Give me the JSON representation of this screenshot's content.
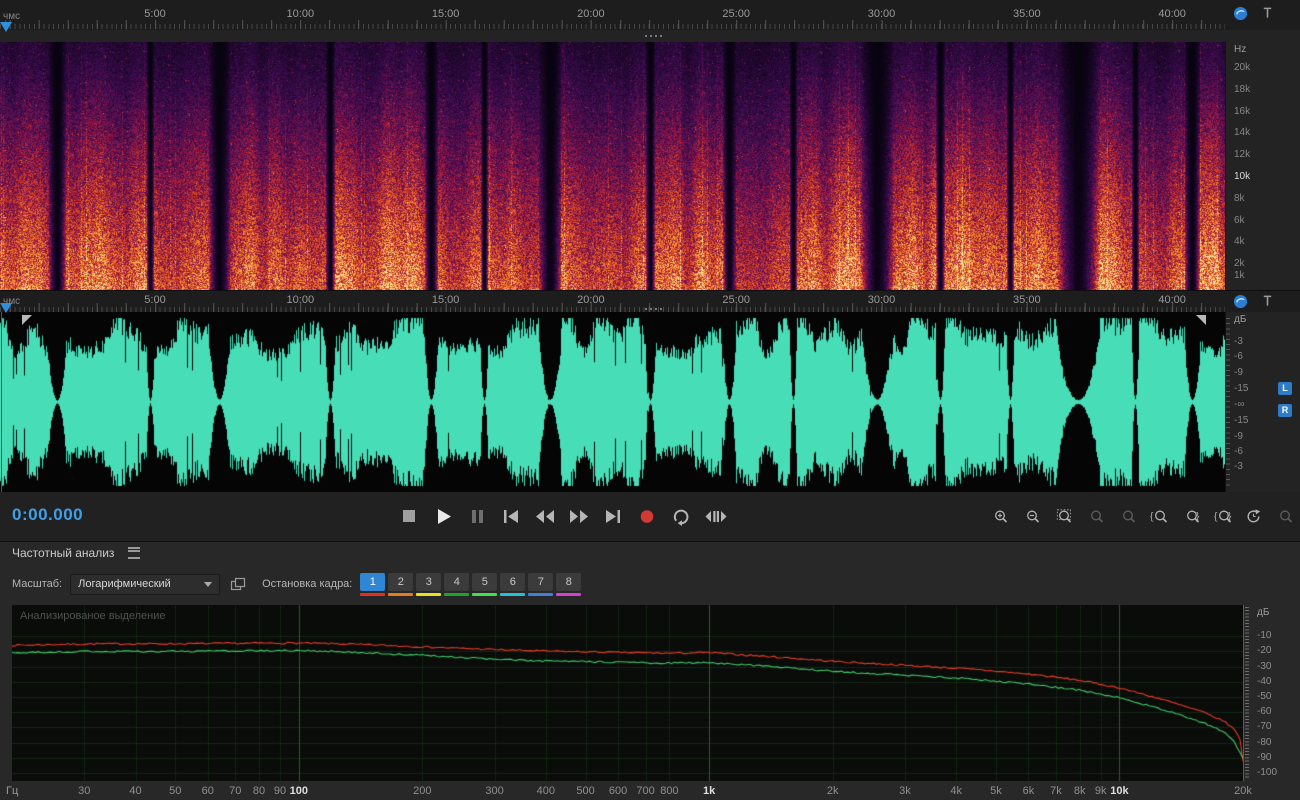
{
  "colors": {
    "accent_blue": "#2f8fde",
    "time_display": "#3fa0e8",
    "waveform": "#46ddb7",
    "record": "#d23b35"
  },
  "ruler_top": {
    "unit": "чмс",
    "ticks": [
      "5:00",
      "10:00",
      "15:00",
      "20:00",
      "25:00",
      "30:00",
      "35:00",
      "40:00"
    ]
  },
  "ruler_wave": {
    "unit": "чмс",
    "ticks": [
      "5:00",
      "10:00",
      "15:00",
      "20:00",
      "25:00",
      "30:00",
      "35:00",
      "40:00"
    ]
  },
  "spectrogram_scale": {
    "unit": "Hz",
    "labels": [
      "20k",
      "18k",
      "16k",
      "14k",
      "12k",
      "10k",
      "8k",
      "6k",
      "4k",
      "2k",
      "1k"
    ],
    "highlight": "10k"
  },
  "waveform_scale": {
    "unit": "дБ",
    "labels": [
      "-3",
      "-6",
      "-9",
      "-15",
      "-∞",
      "-15",
      "-9",
      "-6",
      "-3"
    ],
    "channels": [
      "L",
      "R"
    ]
  },
  "transport": {
    "time": "0:00.000",
    "buttons": [
      {
        "name": "stop"
      },
      {
        "name": "play"
      },
      {
        "name": "pause",
        "dim": true
      },
      {
        "name": "skip-start"
      },
      {
        "name": "rewind"
      },
      {
        "name": "fast-forward"
      },
      {
        "name": "skip-end"
      },
      {
        "name": "record"
      },
      {
        "name": "loop"
      },
      {
        "name": "skip-selection"
      }
    ],
    "zoom_buttons": [
      {
        "name": "zoom-in",
        "deco": "plus"
      },
      {
        "name": "zoom-out",
        "deco": "minus"
      },
      {
        "name": "zoom-in-time",
        "deco": "box"
      },
      {
        "name": "zoom-out-time",
        "deco": "plain",
        "dim": true
      },
      {
        "name": "zoom-amplitude",
        "deco": "plain",
        "dim": true
      },
      {
        "name": "zoom-selection-left",
        "deco": "brl"
      },
      {
        "name": "zoom-selection-right",
        "deco": "brr"
      },
      {
        "name": "zoom-selection",
        "deco": "brb"
      },
      {
        "name": "reset-zoom",
        "deco": "reset"
      },
      {
        "name": "zoom-last",
        "deco": "plain",
        "dim": true
      }
    ]
  },
  "analysis": {
    "title": "Частотный анализ",
    "scale_label": "Масштаб:",
    "scale_value": "Логарифмический",
    "hold_label": "Остановка кадра:",
    "holds": [
      {
        "label": "1",
        "color": "#e03123",
        "selected": true
      },
      {
        "label": "2",
        "color": "#e57d17"
      },
      {
        "label": "3",
        "color": "#e8e01f"
      },
      {
        "label": "4",
        "color": "#1ea32c"
      },
      {
        "label": "5",
        "color": "#3fe04c"
      },
      {
        "label": "6",
        "color": "#25c0d8"
      },
      {
        "label": "7",
        "color": "#3f7fd9"
      },
      {
        "label": "8",
        "color": "#d63fd6"
      }
    ],
    "overlay_label": "Анализированое выделение"
  },
  "chart_data": {
    "type": "line",
    "x_scale": "log",
    "x_unit": "Гц",
    "y_unit": "дБ",
    "x_range": [
      20,
      20000
    ],
    "y_range": [
      -105,
      0
    ],
    "grid": true,
    "x_ticks": [
      {
        "f": 30,
        "label": "30"
      },
      {
        "f": 40,
        "label": "40"
      },
      {
        "f": 50,
        "label": "50"
      },
      {
        "f": 60,
        "label": "60"
      },
      {
        "f": 70,
        "label": "70"
      },
      {
        "f": 80,
        "label": "80"
      },
      {
        "f": 90,
        "label": "90"
      },
      {
        "f": 100,
        "label": "100",
        "major": true
      },
      {
        "f": 200,
        "label": "200"
      },
      {
        "f": 300,
        "label": "300"
      },
      {
        "f": 400,
        "label": "400"
      },
      {
        "f": 500,
        "label": "500"
      },
      {
        "f": 600,
        "label": "600"
      },
      {
        "f": 700,
        "label": "700"
      },
      {
        "f": 800,
        "label": "800"
      },
      {
        "f": 1000,
        "label": "1k",
        "major": true
      },
      {
        "f": 2000,
        "label": "2k"
      },
      {
        "f": 3000,
        "label": "3k"
      },
      {
        "f": 4000,
        "label": "4k"
      },
      {
        "f": 5000,
        "label": "5k"
      },
      {
        "f": 6000,
        "label": "6k"
      },
      {
        "f": 7000,
        "label": "7k"
      },
      {
        "f": 8000,
        "label": "8k"
      },
      {
        "f": 9000,
        "label": "9k"
      },
      {
        "f": 10000,
        "label": "10k",
        "major": true
      },
      {
        "f": 20000,
        "label": "20k"
      }
    ],
    "y_ticks": [
      -10,
      -20,
      -30,
      -40,
      -50,
      -60,
      -70,
      -80,
      -90,
      -100
    ],
    "series": [
      {
        "name": "left",
        "color": "#e23b28",
        "points": [
          [
            20,
            -16
          ],
          [
            25,
            -15.5
          ],
          [
            32,
            -15
          ],
          [
            40,
            -15
          ],
          [
            50,
            -15
          ],
          [
            63,
            -14.8
          ],
          [
            80,
            -14.6
          ],
          [
            100,
            -14.5
          ],
          [
            125,
            -15
          ],
          [
            160,
            -16
          ],
          [
            200,
            -17
          ],
          [
            250,
            -18
          ],
          [
            315,
            -19
          ],
          [
            400,
            -19.8
          ],
          [
            500,
            -20.3
          ],
          [
            630,
            -20.8
          ],
          [
            800,
            -21.2
          ],
          [
            1000,
            -20.8
          ],
          [
            1250,
            -22.5
          ],
          [
            1600,
            -24.5
          ],
          [
            2000,
            -26.5
          ],
          [
            2500,
            -28
          ],
          [
            3150,
            -29.5
          ],
          [
            4000,
            -31
          ],
          [
            5000,
            -33
          ],
          [
            6300,
            -35.5
          ],
          [
            8000,
            -39
          ],
          [
            10000,
            -44
          ],
          [
            12500,
            -51
          ],
          [
            16000,
            -60
          ],
          [
            18000,
            -66
          ],
          [
            19000,
            -71
          ],
          [
            19700,
            -78
          ],
          [
            20000,
            -92
          ]
        ]
      },
      {
        "name": "right",
        "color": "#3fca6b",
        "points": [
          [
            20,
            -21
          ],
          [
            25,
            -20.5
          ],
          [
            32,
            -20
          ],
          [
            40,
            -20
          ],
          [
            50,
            -20
          ],
          [
            63,
            -19.8
          ],
          [
            80,
            -19.6
          ],
          [
            100,
            -19.5
          ],
          [
            125,
            -20
          ],
          [
            160,
            -21.5
          ],
          [
            200,
            -22.5
          ],
          [
            250,
            -24
          ],
          [
            315,
            -25.5
          ],
          [
            400,
            -26.3
          ],
          [
            500,
            -26.8
          ],
          [
            630,
            -27.3
          ],
          [
            800,
            -27.7
          ],
          [
            1000,
            -27.3
          ],
          [
            1250,
            -29
          ],
          [
            1600,
            -31
          ],
          [
            2000,
            -33
          ],
          [
            2500,
            -34.5
          ],
          [
            3150,
            -36
          ],
          [
            4000,
            -37.5
          ],
          [
            5000,
            -39.5
          ],
          [
            6300,
            -42
          ],
          [
            8000,
            -45.5
          ],
          [
            10000,
            -50.5
          ],
          [
            12500,
            -57.5
          ],
          [
            16000,
            -67
          ],
          [
            18000,
            -73
          ],
          [
            19000,
            -79
          ],
          [
            19700,
            -87
          ],
          [
            20000,
            -90
          ]
        ]
      }
    ]
  }
}
